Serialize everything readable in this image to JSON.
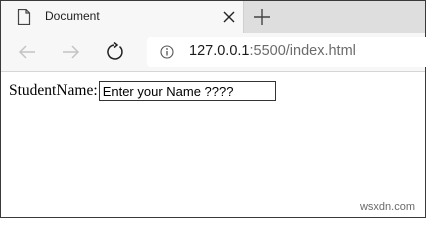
{
  "browser": {
    "tab": {
      "title": "Document",
      "icon": "document-icon"
    },
    "new_tab_icon": "plus-icon",
    "address": {
      "host": "127.0.0.1",
      "port_path": ":5500/index.html"
    }
  },
  "page": {
    "form": {
      "label": "StudentName:",
      "input_placeholder": "Enter your Name ????"
    }
  },
  "watermark": "wsxdn.com"
}
